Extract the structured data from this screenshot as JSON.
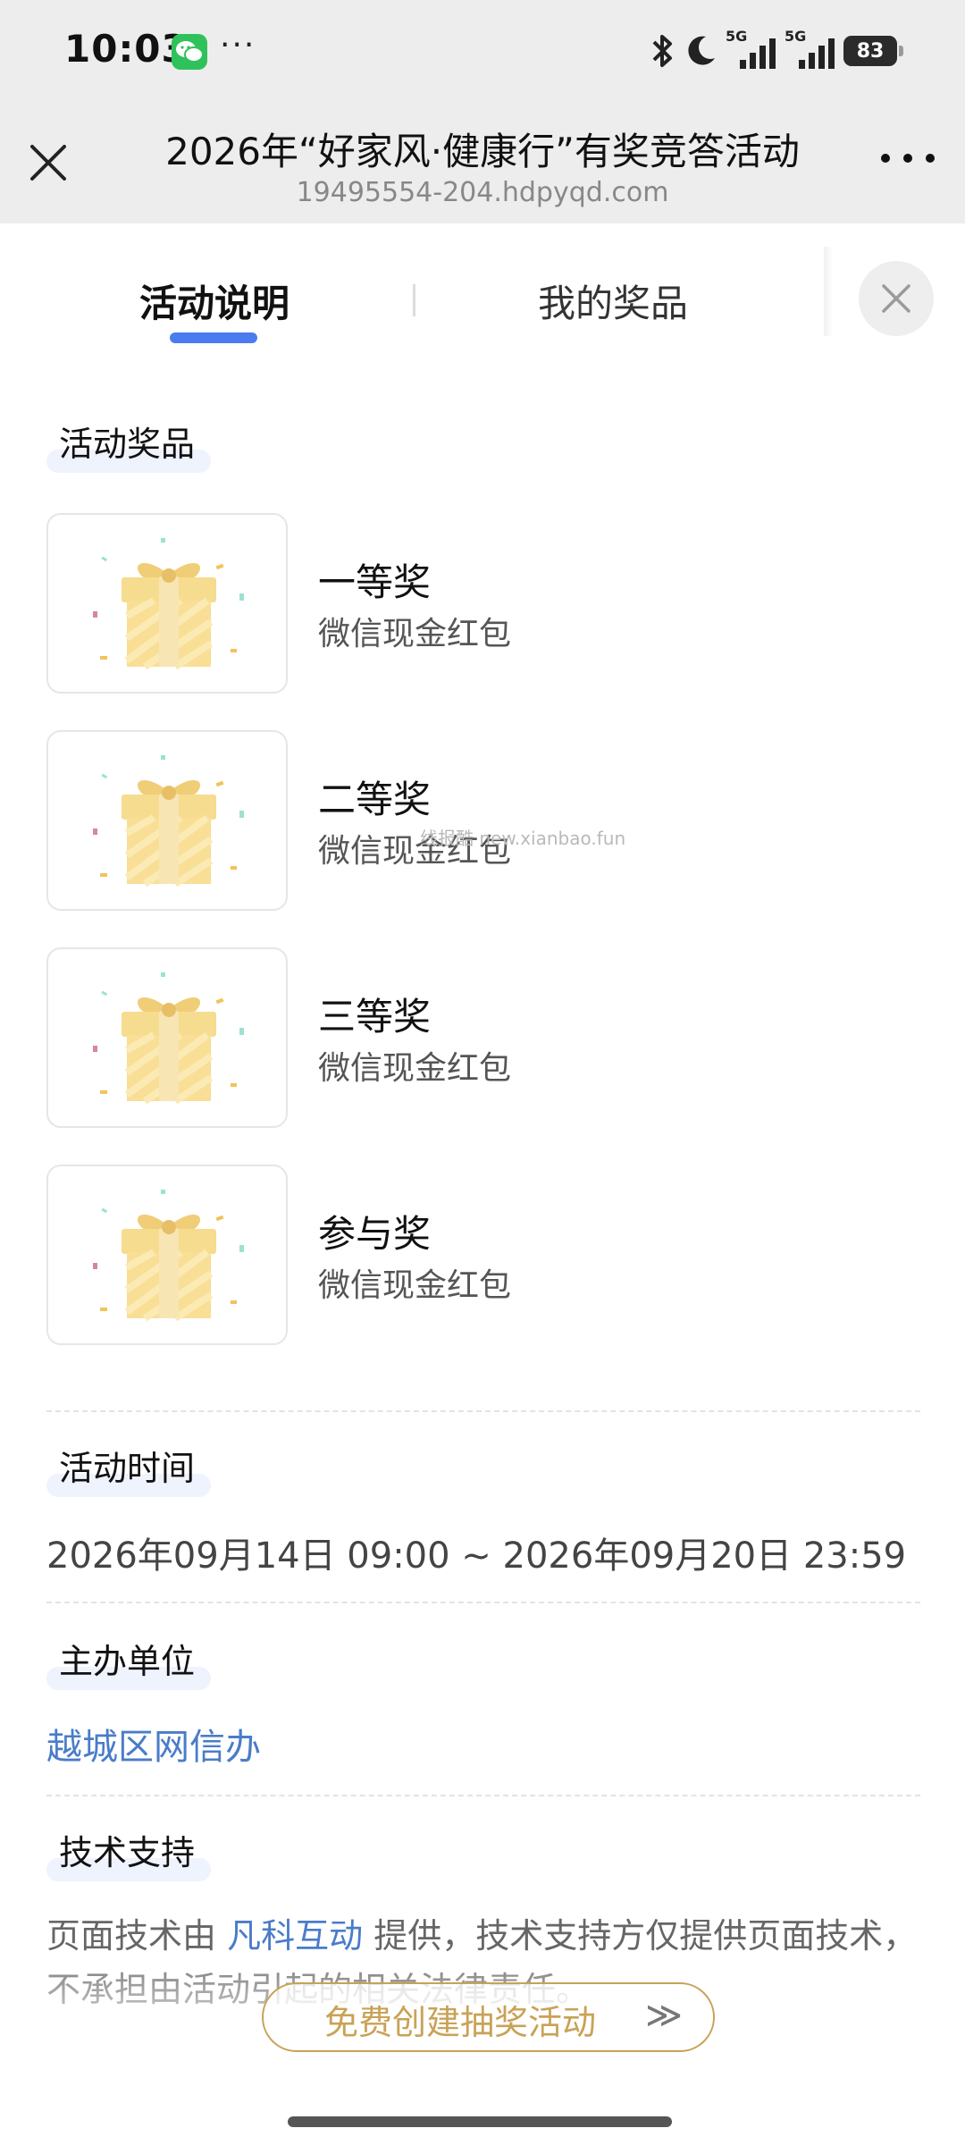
{
  "status_bar": {
    "time": "10:03",
    "more": "···",
    "signal_1": "5G",
    "signal_2": "5G",
    "battery": "83",
    "icons": [
      "wechat-icon",
      "bluetooth-icon",
      "moon-icon",
      "signal-icon",
      "battery-icon"
    ]
  },
  "title_bar": {
    "title": "2026年“好家风·健康行”有奖竞答活动",
    "url": "19495554-204.hdpyqd.com"
  },
  "tabs": [
    {
      "label": "活动说明",
      "active": true
    },
    {
      "label": "我的奖品",
      "active": false
    }
  ],
  "prizes_section": {
    "heading": "活动奖品",
    "items": [
      {
        "name": "一等奖",
        "desc": "微信现金红包"
      },
      {
        "name": "二等奖",
        "desc": "微信现金红包"
      },
      {
        "name": "三等奖",
        "desc": "微信现金红包"
      },
      {
        "name": "参与奖",
        "desc": "微信现金红包"
      }
    ]
  },
  "watermark": "线报酷 new.xianbao.fun",
  "time_section": {
    "heading": "活动时间",
    "value": "2026年09月14日 09:00 ~ 2026年09月20日 23:59"
  },
  "organizer_section": {
    "heading": "主办单位",
    "value": "越城区网信办"
  },
  "tech_section": {
    "heading": "技术支持",
    "prefix": "页面技术由 ",
    "provider": "凡科互动",
    "suffix": " 提供，技术支持方仅提供页面技术，不承担由活动引起的相关法律责任。"
  },
  "cta": {
    "label": "免费创建抽奖活动",
    "arrow": "≫"
  },
  "colors": {
    "accent_blue": "#4a7cf0",
    "link_blue": "#4a7cc9",
    "gold": "#c9a256",
    "header_gray": "#ededed"
  }
}
